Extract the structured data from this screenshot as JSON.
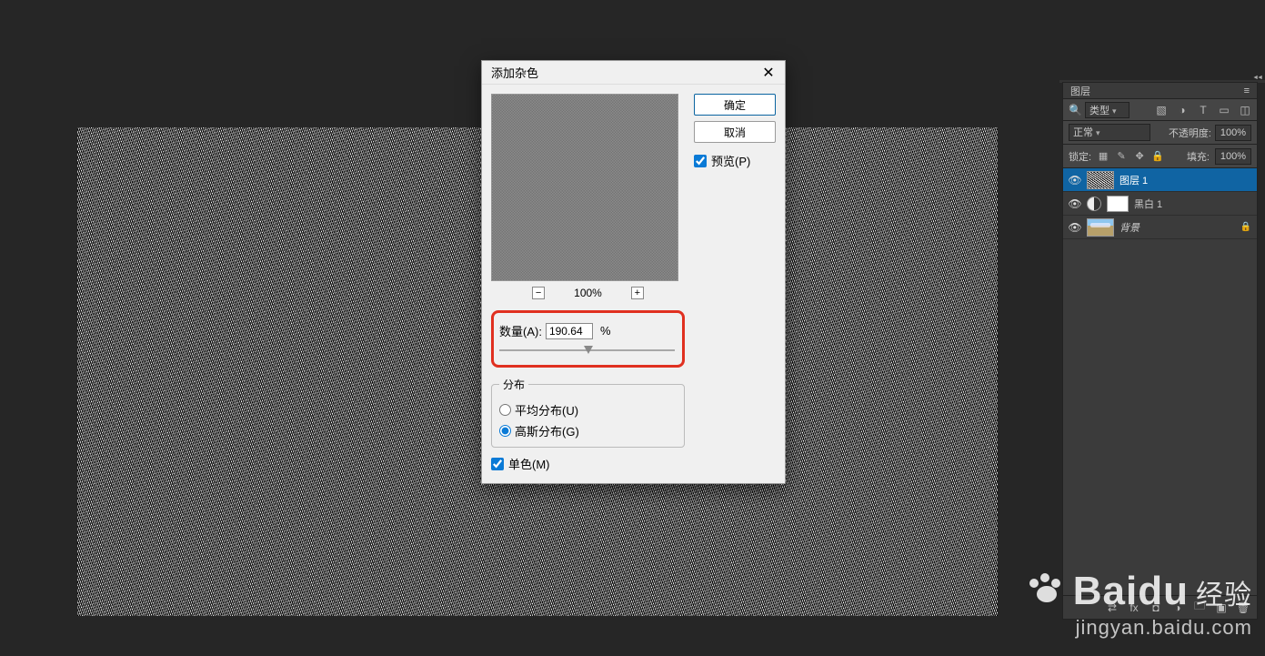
{
  "dialog": {
    "title": "添加杂色",
    "ok": "确定",
    "cancel": "取消",
    "preview_label": "预览(P)",
    "preview_checked": true,
    "zoom_percent": "100%",
    "amount_label": "数量(A):",
    "amount_value": "190.64",
    "amount_unit": "%",
    "distribution_legend": "分布",
    "uniform_label": "平均分布(U)",
    "gaussian_label": "高斯分布(G)",
    "gaussian_selected": true,
    "mono_label": "单色(M)",
    "mono_checked": true
  },
  "panel": {
    "tab": "图层",
    "filter_label": "类型",
    "blend_mode": "正常",
    "opacity_label": "不透明度:",
    "opacity_value": "100%",
    "lock_label": "锁定:",
    "fill_label": "填充:",
    "fill_value": "100%",
    "layers": [
      {
        "name": "图层 1",
        "thumb": "noise",
        "selected": true
      },
      {
        "name": "黑白 1",
        "thumb": "adjustment",
        "selected": false
      },
      {
        "name": "背景",
        "thumb": "photo",
        "selected": false,
        "locked": true
      }
    ]
  },
  "watermark": {
    "brand_left": "Bai",
    "brand_right": "du",
    "label": "经验",
    "url": "jingyan.baidu.com"
  }
}
